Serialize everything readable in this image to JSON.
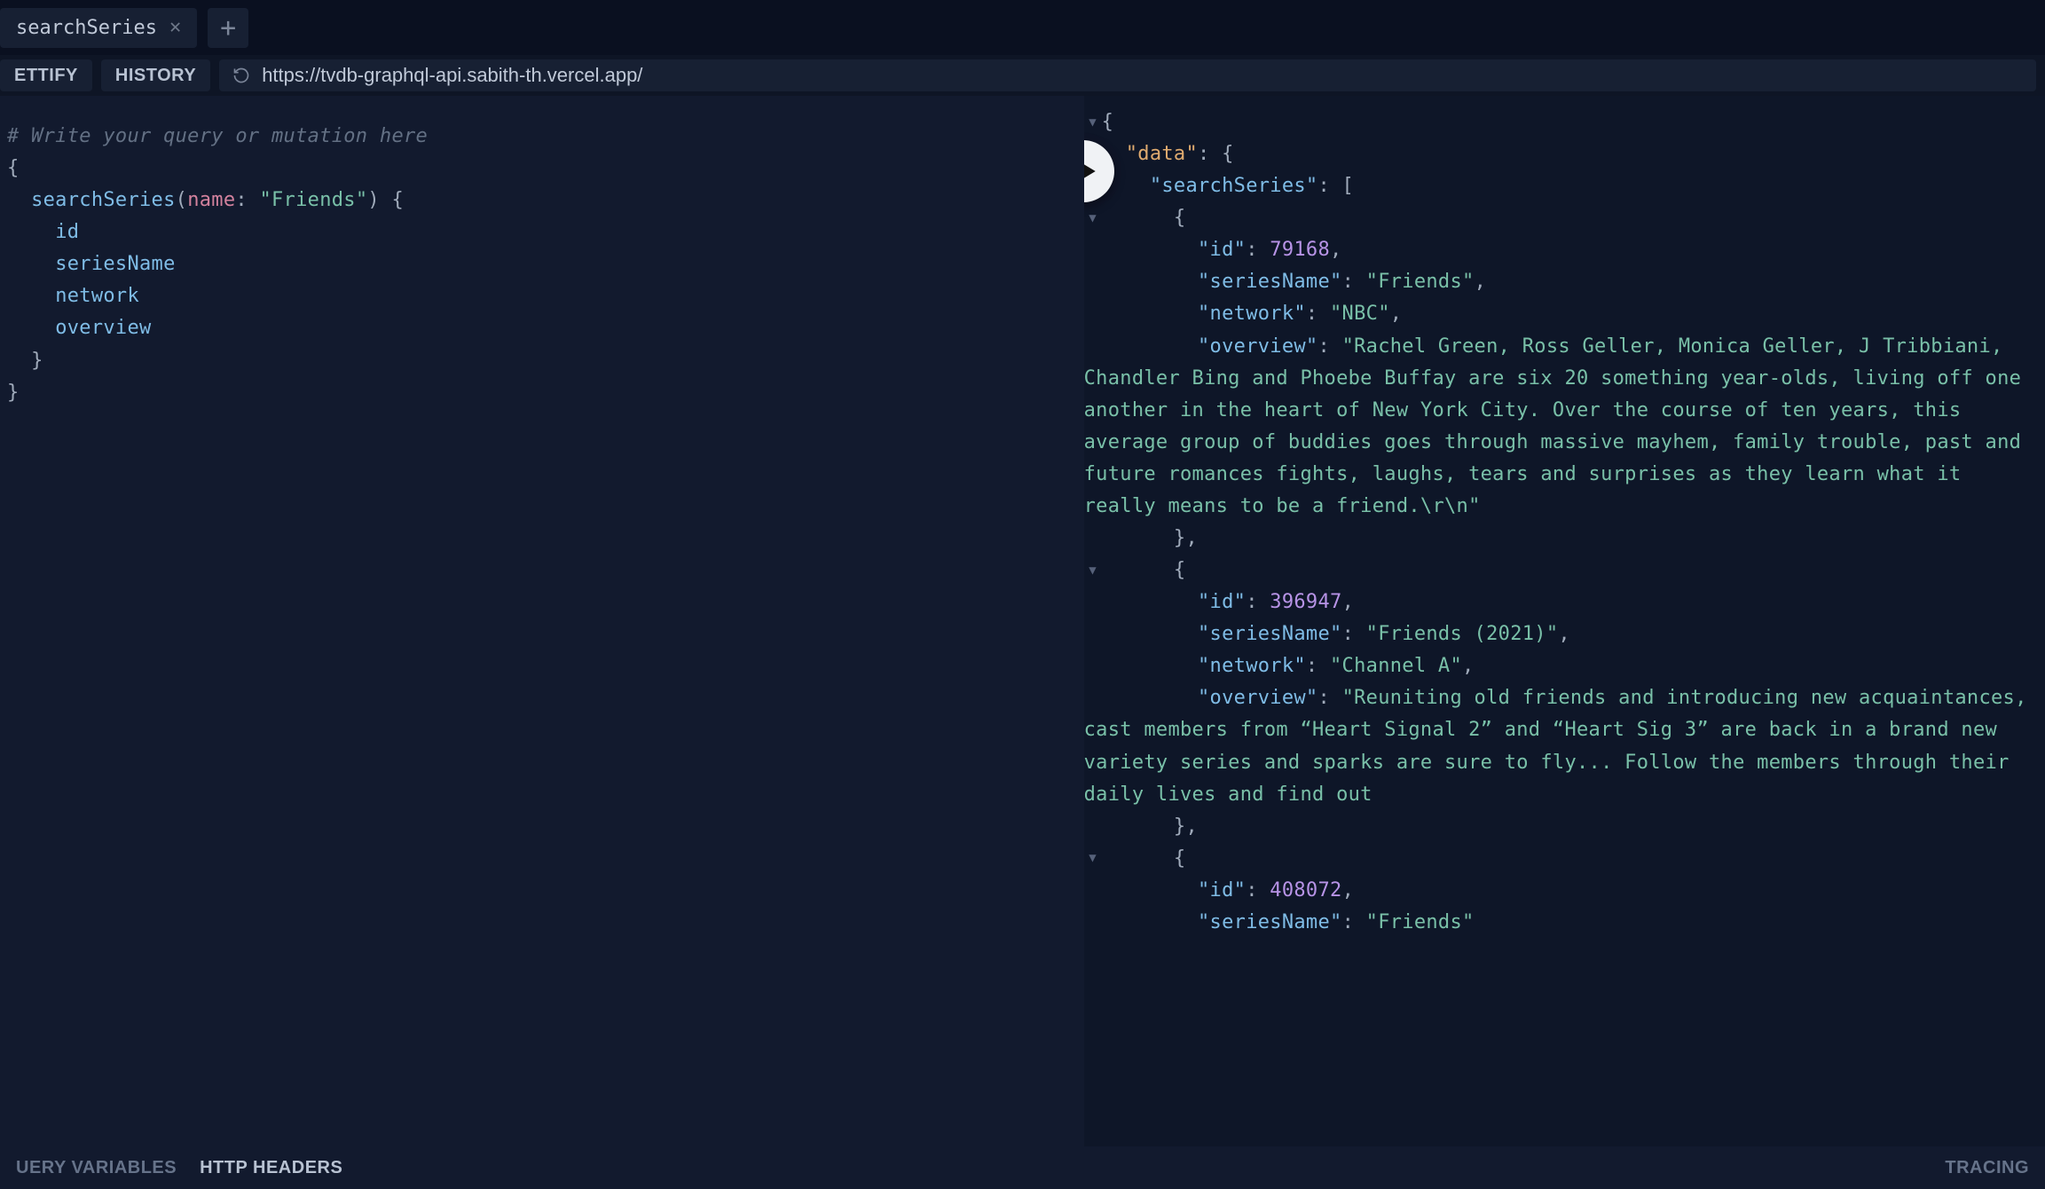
{
  "tabs": {
    "active": {
      "title": "searchSeries"
    }
  },
  "toolbar": {
    "prettify": "ETTIFY",
    "history": "HISTORY",
    "endpoint": "https://tvdb-graphql-api.sabith-th.vercel.app/"
  },
  "query": {
    "comment": "# Write your query or mutation here",
    "operation_open": "{",
    "field_name": "searchSeries",
    "arg_name": "name",
    "arg_value": "\"Friends\"",
    "sel1": "id",
    "sel2": "seriesName",
    "sel3": "network",
    "sel4": "overview",
    "close_inner": "}",
    "close_outer": "}"
  },
  "result": {
    "open": "{",
    "data_key": "\"data\"",
    "search_key": "\"searchSeries\"",
    "items": [
      {
        "id_key": "\"id\"",
        "id_val": "79168",
        "seriesName_key": "\"seriesName\"",
        "seriesName_val": "\"Friends\"",
        "network_key": "\"network\"",
        "network_val": "\"NBC\"",
        "overview_key": "\"overview\"",
        "overview_val": "\"Rachel Green, Ross Geller, Monica Geller, J Tribbiani, Chandler Bing and Phoebe Buffay are six 20 something year-olds, living off one another in the heart of New York City. Over the course of ten years, this average group of buddies goes through massive mayhem, family trouble, past and future romances fights, laughs, tears and surprises as they learn what it really means to be a friend.\\r\\n\""
      },
      {
        "id_key": "\"id\"",
        "id_val": "396947",
        "seriesName_key": "\"seriesName\"",
        "seriesName_val": "\"Friends (2021)\"",
        "network_key": "\"network\"",
        "network_val": "\"Channel A\"",
        "overview_key": "\"overview\"",
        "overview_val": "\"Reuniting old friends and introducing new acquaintances, cast members from “Heart Signal 2” and “Heart Sig 3” are back in a brand new variety series and sparks are sure to fly... Follow the members through their daily lives and find out"
      },
      {
        "id_key": "\"id\"",
        "id_val": "408072",
        "seriesName_key": "\"seriesName\"",
        "seriesName_val": "\"Friends\""
      }
    ]
  },
  "bottom": {
    "query_vars": "UERY VARIABLES",
    "http_headers": "HTTP HEADERS",
    "tracing": "TRACING"
  }
}
